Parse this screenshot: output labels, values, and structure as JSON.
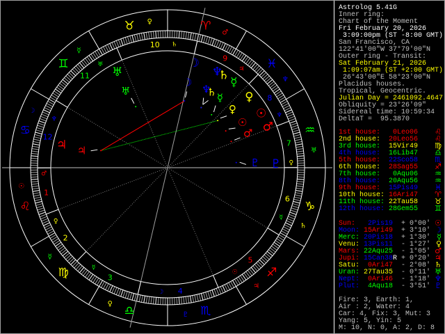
{
  "info": [
    {
      "text": "Astrolog 5.41G",
      "color": "#ffffff"
    },
    {
      "text": "Inner ring:",
      "color": "#c0c0c0"
    },
    {
      "text": "Chart of the Moment",
      "color": "#c0c0c0"
    },
    {
      "text": "Fri February 20, 2026",
      "color": "#ffffff"
    },
    {
      "text": " 3:09:00pm (ST -8:00 GMT)",
      "color": "#ffffff"
    },
    {
      "text": "San Francisco, CA",
      "color": "#c0c0c0"
    },
    {
      "text": "122°41'00\"W 37°79'00\"N",
      "color": "#c0c0c0"
    },
    {
      "text": "Outer ring - Transit:",
      "color": "#c0c0c0"
    },
    {
      "text": "Sat February 21, 2026",
      "color": "#ffff00"
    },
    {
      "text": " 1:09:07am (ST +2:00 GMT)",
      "color": "#ffff00"
    },
    {
      "text": " 26°43'00\"E 58°23'00\"N",
      "color": "#c0c0c0"
    },
    {
      "text": "Placidus houses.",
      "color": "#c0c0c0"
    },
    {
      "text": "Tropical, Geocentric.",
      "color": "#c0c0c0"
    },
    {
      "text": "Julian Day = 2461092.4647",
      "color": "#ffff00"
    },
    {
      "text": "Obliquity = 23°26'09\"",
      "color": "#c0c0c0"
    },
    {
      "text": "Sidereal time: 10:59:34",
      "color": "#c0c0c0"
    },
    {
      "text": "DeltaT =  95.3870",
      "color": "#c0c0c0"
    }
  ],
  "houses": [
    {
      "label": "1st house:",
      "value": "0Leo06",
      "glyph": "♌",
      "label_color": "#ff0000",
      "value_color": "#ff0000",
      "lon": 120.1,
      "ruler": "♂",
      "ruler_color": "#ff0000"
    },
    {
      "label": "2nd house:",
      "value": "20Leo56",
      "glyph": "♌",
      "label_color": "#ffff00",
      "value_color": "#ff0000",
      "lon": 140.93,
      "ruler": "♀",
      "ruler_color": "#ffff00"
    },
    {
      "label": "3rd house:",
      "value": "15Vir49",
      "glyph": "♍",
      "label_color": "#00ff00",
      "value_color": "#ffff00",
      "lon": 165.82,
      "ruler": "☿",
      "ruler_color": "#00ff00"
    },
    {
      "label": "4th house:",
      "value": "16Lib47",
      "glyph": "♎",
      "label_color": "#0000ff",
      "value_color": "#00ff00",
      "lon": 196.78,
      "ruler": "☽",
      "ruler_color": "#0000ff"
    },
    {
      "label": "5th house:",
      "value": "22Sco58",
      "glyph": "♏",
      "label_color": "#ff0000",
      "value_color": "#0000ff",
      "lon": 232.97,
      "ruler": "☉",
      "ruler_color": "#ff0000"
    },
    {
      "label": "6th house:",
      "value": "28Sag55",
      "glyph": "♐",
      "label_color": "#ffff00",
      "value_color": "#ff0000",
      "lon": 268.92,
      "ruler": "☿",
      "ruler_color": "#00ff00"
    },
    {
      "label": "7th house:",
      "value": "0Aqu06",
      "glyph": "♒",
      "label_color": "#00ff00",
      "value_color": "#00ff00",
      "lon": 300.1,
      "ruler": "♀",
      "ruler_color": "#ffff00"
    },
    {
      "label": "8th house:",
      "value": "20Aqu56",
      "glyph": "♒",
      "label_color": "#0000ff",
      "value_color": "#00ff00",
      "lon": 320.93,
      "ruler": "♆",
      "ruler_color": "#0000ff"
    },
    {
      "label": "9th house:",
      "value": "15Pis49",
      "glyph": "♓",
      "label_color": "#ff0000",
      "value_color": "#0000ff",
      "lon": 345.82,
      "ruler": "♃",
      "ruler_color": "#ff0000"
    },
    {
      "label": "10th house:",
      "value": "16Ari47",
      "glyph": "♈",
      "label_color": "#ffff00",
      "value_color": "#ff0000",
      "lon": 16.78,
      "ruler": "♄",
      "ruler_color": "#ffff00"
    },
    {
      "label": "11th house:",
      "value": "22Tau58",
      "glyph": "♉",
      "label_color": "#00ff00",
      "value_color": "#ffff00",
      "lon": 52.97,
      "ruler": "♅",
      "ruler_color": "#00ff00"
    },
    {
      "label": "12th house:",
      "value": "28Gem55",
      "glyph": "♊",
      "label_color": "#0000ff",
      "value_color": "#00ff00",
      "lon": 88.92,
      "ruler": "♆",
      "ruler_color": "#0000ff"
    }
  ],
  "planets": [
    {
      "name": "Sun:",
      "value": "2Pis19",
      "retro": "",
      "aspect": "+ 0°00'",
      "glyph": "☉",
      "color": "#ff0000",
      "value_color": "#0000ff",
      "lon": 332.32
    },
    {
      "name": "Moon:",
      "value": "15Ari49",
      "retro": "",
      "aspect": "+ 3°10'",
      "glyph": "☽",
      "color": "#0000ff",
      "value_color": "#ff0000",
      "lon": 15.82
    },
    {
      "name": "Merc:",
      "value": "20Pis18",
      "retro": "",
      "aspect": "+ 1°30'",
      "glyph": "☿",
      "color": "#00ff00",
      "value_color": "#0000ff",
      "lon": 350.3
    },
    {
      "name": "Venu:",
      "value": "13Pis11",
      "retro": "",
      "aspect": "- 1°27'",
      "glyph": "♀",
      "color": "#ffff00",
      "value_color": "#0000ff",
      "lon": 343.18
    },
    {
      "name": "Mars:",
      "value": "22Aqu25",
      "retro": "",
      "aspect": "- 1°05'",
      "glyph": "♂",
      "color": "#ff0000",
      "value_color": "#00ff00",
      "lon": 322.42
    },
    {
      "name": "Jupi:",
      "value": "15Can38",
      "retro": "R",
      "aspect": "+ 0°20'",
      "glyph": "♃",
      "color": "#ff0000",
      "value_color": "#0000ff",
      "lon": 105.63
    },
    {
      "name": "Satu:",
      "value": "0Ari47",
      "retro": "",
      "aspect": "- 2°08'",
      "glyph": "♄",
      "color": "#ffff00",
      "value_color": "#ff0000",
      "lon": 0.78
    },
    {
      "name": "Uran:",
      "value": "27Tau35",
      "retro": "",
      "aspect": "- 0°11'",
      "glyph": "♅",
      "color": "#00ff00",
      "value_color": "#ffff00",
      "lon": 57.58
    },
    {
      "name": "Nept:",
      "value": "0Ari46",
      "retro": "",
      "aspect": "- 1°18'",
      "glyph": "♆",
      "color": "#0000ff",
      "value_color": "#ff0000",
      "lon": 0.77
    },
    {
      "name": "Plut:",
      "value": "4Aqu18",
      "retro": "",
      "aspect": "- 3°51'",
      "glyph": "♇",
      "color": "#0000ff",
      "value_color": "#00ff00",
      "lon": 304.3
    }
  ],
  "summary": [
    "Fire: 3, Earth: 1,",
    "Air : 2, Water: 4",
    "Car: 4, Fix: 3, Mut: 3",
    "Yang: 5, Yin: 5",
    "M: 10, N: 0, A: 2, D: 8"
  ],
  "signs": [
    {
      "glyph": "♈",
      "color": "#ff0000",
      "ruler": "♂",
      "ruler_color": "#ff0000"
    },
    {
      "glyph": "♉",
      "color": "#ffff00",
      "ruler": "♀",
      "ruler_color": "#ffff00"
    },
    {
      "glyph": "♊",
      "color": "#00ff00",
      "ruler": "☿",
      "ruler_color": "#00ff00"
    },
    {
      "glyph": "♋",
      "color": "#0000ff",
      "ruler": "☽",
      "ruler_color": "#0000ff"
    },
    {
      "glyph": "♌",
      "color": "#ff0000",
      "ruler": "☉",
      "ruler_color": "#ff0000"
    },
    {
      "glyph": "♍",
      "color": "#ffff00",
      "ruler": "☿",
      "ruler_color": "#00ff00"
    },
    {
      "glyph": "♎",
      "color": "#00ff00",
      "ruler": "♀",
      "ruler_color": "#ffff00"
    },
    {
      "glyph": "♏",
      "color": "#0000ff",
      "ruler": "♇",
      "ruler_color": "#0000ff"
    },
    {
      "glyph": "♐",
      "color": "#ff0000",
      "ruler": "♃",
      "ruler_color": "#ff0000"
    },
    {
      "glyph": "♑",
      "color": "#ffff00",
      "ruler": "♄",
      "ruler_color": "#ffff00"
    },
    {
      "glyph": "♒",
      "color": "#00ff00",
      "ruler": "♅",
      "ruler_color": "#00ff00"
    },
    {
      "glyph": "♓",
      "color": "#0000ff",
      "ruler": "♆",
      "ruler_color": "#0000ff"
    }
  ],
  "house_numbers": [
    "1",
    "2",
    "3",
    "4",
    "5",
    "6",
    "7",
    "8",
    "9",
    "10",
    "11",
    "12"
  ],
  "aspects": [
    {
      "from": 5,
      "to": 1,
      "type": "square",
      "color": "#ff0000"
    },
    {
      "from": 5,
      "to": 3,
      "type": "trine",
      "color": "#00ff00"
    }
  ]
}
